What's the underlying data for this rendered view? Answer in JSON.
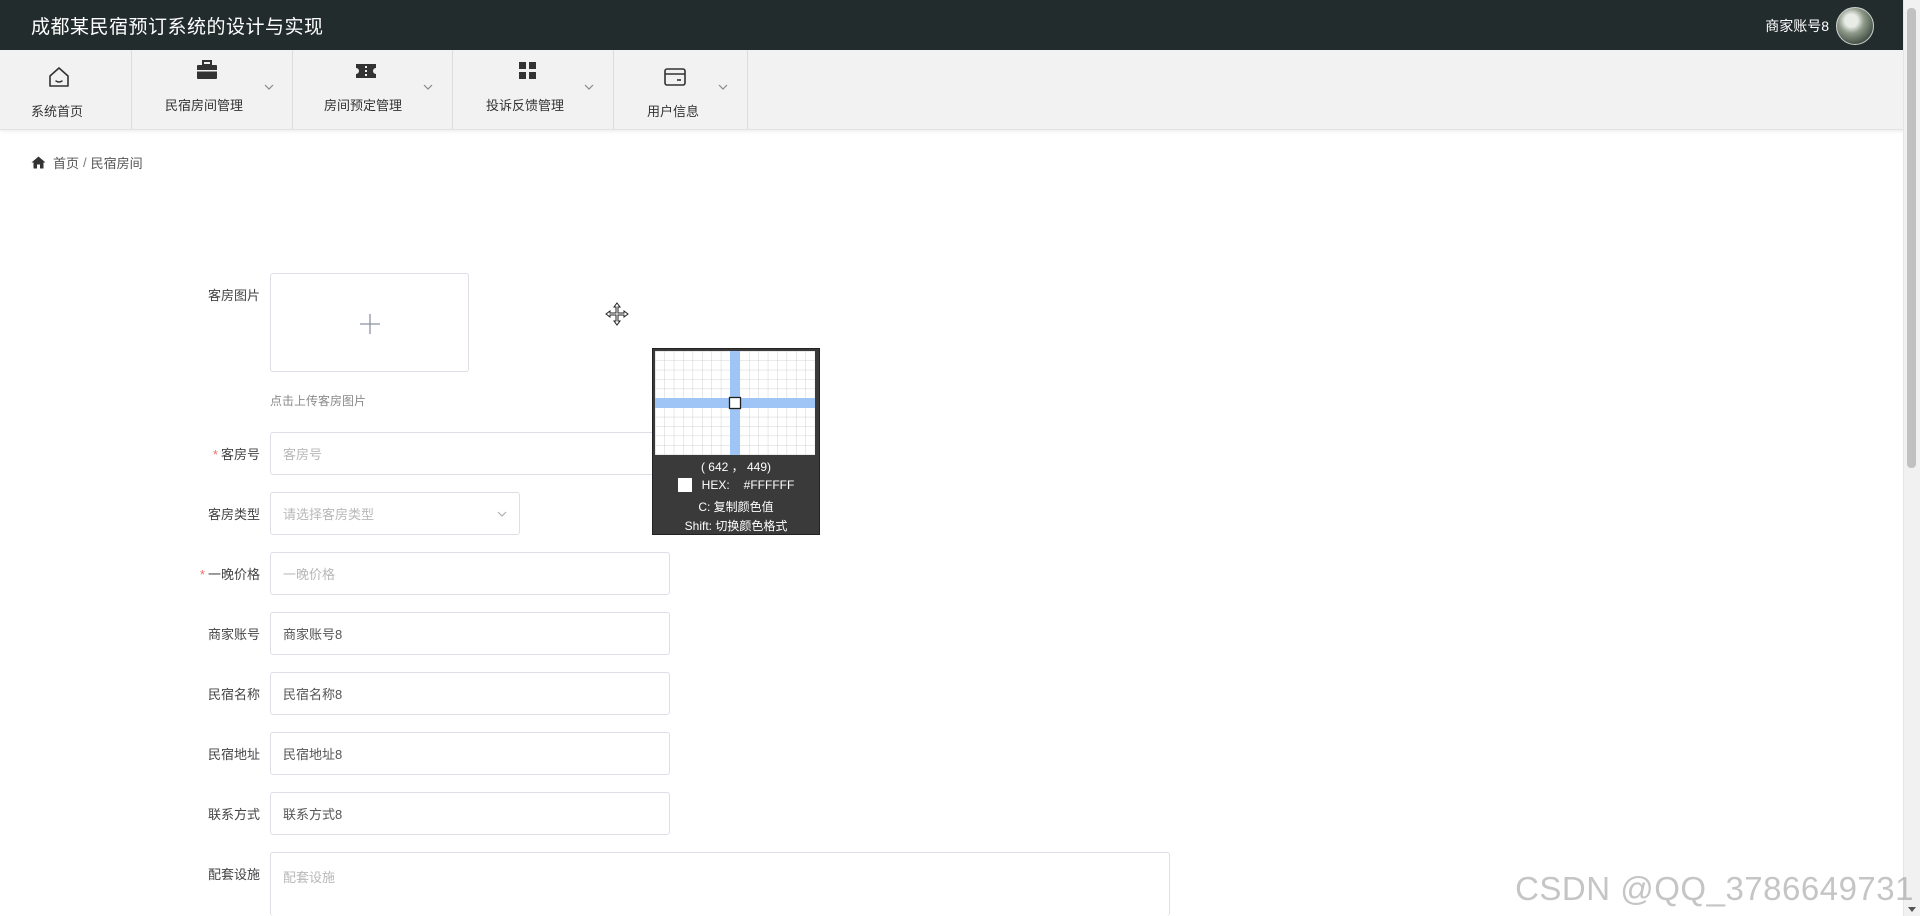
{
  "app": {
    "title": "成都某民宿预订系统的设计与实现",
    "user_name": "商家账号8"
  },
  "menu": {
    "home": "系统首页",
    "rooms": "民宿房间管理",
    "booking": "房间预定管理",
    "complaints": "投诉反馈管理",
    "user": "用户信息"
  },
  "breadcrumb": {
    "home": "首页",
    "sep": "/",
    "current": "民宿房间"
  },
  "form": {
    "image_label": "客房图片",
    "image_hint": "点击上传客房图片",
    "room_no_label": "客房号",
    "room_no_placeholder": "客房号",
    "room_type_label": "客房类型",
    "room_type_placeholder": "请选择客房类型",
    "price_label": "一晚价格",
    "price_placeholder": "一晚价格",
    "merchant_label": "商家账号",
    "merchant_value": "商家账号8",
    "homestay_name_label": "民宿名称",
    "homestay_name_value": "民宿名称8",
    "address_label": "民宿地址",
    "address_value": "民宿地址8",
    "contact_label": "联系方式",
    "contact_value": "联系方式8",
    "facilities_label": "配套设施",
    "facilities_placeholder": "配套设施",
    "required_mark": "*"
  },
  "picker": {
    "coords": "( 642 ，  449)",
    "hex_label": "HEX:",
    "hex_value": "#FFFFFF",
    "copy_hint": "C: 复制颜色值",
    "shift_hint": "Shift: 切换颜色格式"
  },
  "watermark": "CSDN @QQ_3786649731",
  "colors": {
    "topbar": "#232c2c",
    "menubar": "#f2f2f2",
    "required": "#f56c6c",
    "picker_crosshair": "#9ec5f5"
  }
}
